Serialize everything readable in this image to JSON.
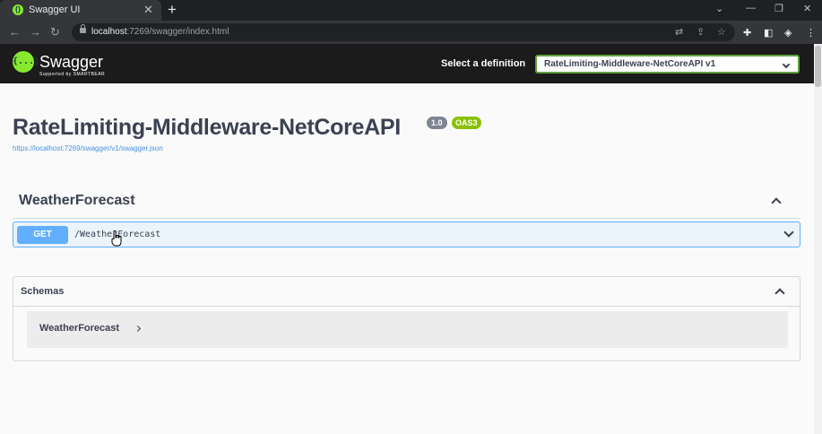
{
  "browser": {
    "tab_title": "Swagger UI",
    "tab_close": "✕",
    "new_tab": "+",
    "url_host": "localhost",
    "url_rest": ":7269/swagger/index.html",
    "window_controls": {
      "minimize": "—",
      "restore": "❐",
      "close": "✕",
      "chevron": "⌄"
    }
  },
  "topbar": {
    "logo_glyph": "{...}",
    "logo_text": "Swagger",
    "logo_sub": "Supported by SMARTBEAR",
    "select_label": "Select a definition",
    "select_value": "RateLimiting-Middleware-NetCoreAPI v1"
  },
  "info": {
    "title": "RateLimiting-Middleware-NetCoreAPI",
    "version": "1.0",
    "oas": "OAS3",
    "spec_url": "https://localhost:7269/swagger/v1/swagger.json"
  },
  "tag": {
    "name": "WeatherForecast",
    "operations": [
      {
        "method": "GET",
        "path": "/WeatherForecast"
      }
    ]
  },
  "schemas": {
    "title": "Schemas",
    "items": [
      {
        "name": "WeatherForecast"
      }
    ]
  },
  "colors": {
    "get": "#61affe",
    "swagger_green": "#85ea2d",
    "oas_badge": "#89bf04",
    "topbar_bg": "#1b1b1b"
  },
  "icons": {
    "back": "arrow-left-icon",
    "forward": "arrow-right-icon",
    "reload": "reload-icon",
    "translate": "translate-icon",
    "share": "share-icon",
    "star": "star-icon",
    "extensions": "puzzle-icon",
    "sidebar": "side-panel-icon",
    "profile": "profile-icon",
    "menu": "kebab-menu-icon"
  }
}
